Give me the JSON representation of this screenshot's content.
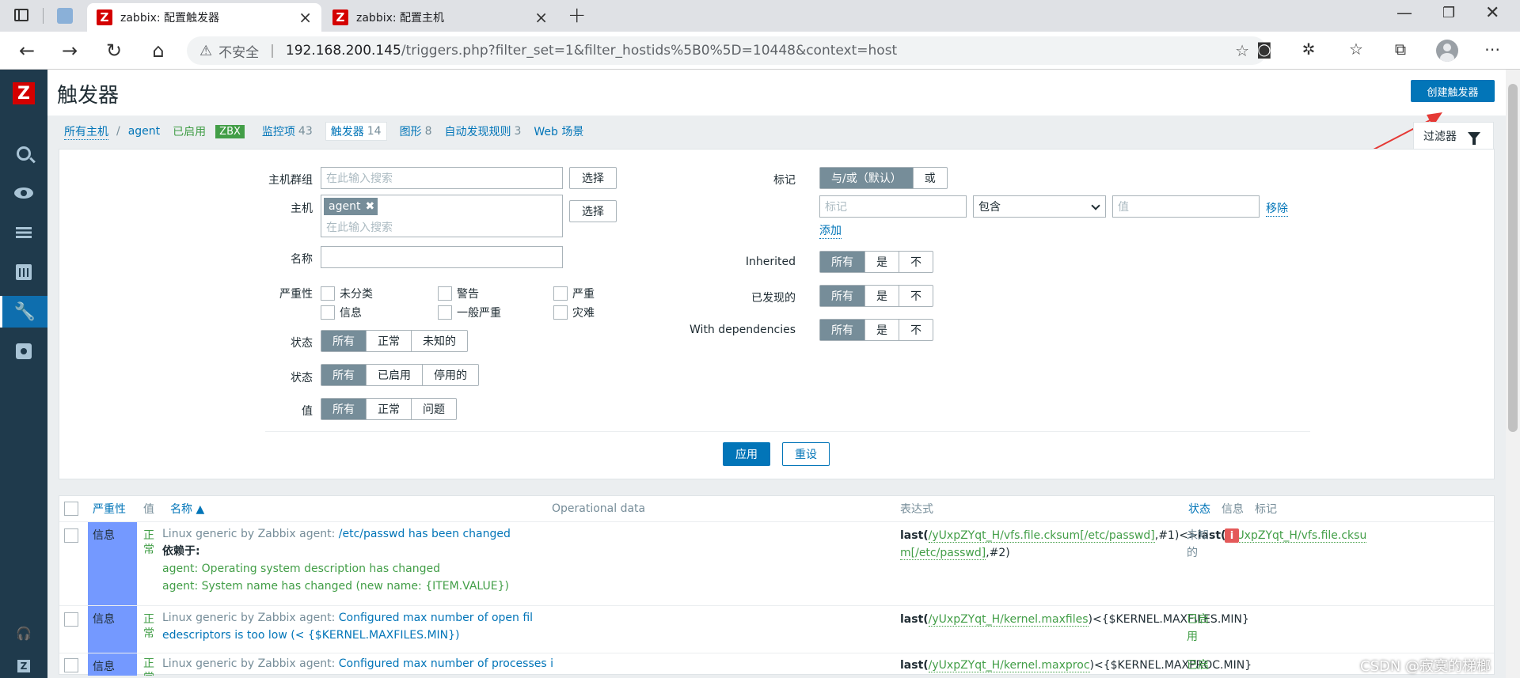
{
  "browser": {
    "tabs": [
      {
        "title": "zabbix: 配置触发器",
        "active": true
      },
      {
        "title": "zabbix: 配置主机",
        "active": false
      }
    ],
    "url_warning": "不安全",
    "url_host": "192.168.200.145",
    "url_path": "/triggers.php?filter_set=1&filter_hostids%5B0%5D=10448&context=host"
  },
  "header": {
    "title": "触发器",
    "create_button": "创建触发器"
  },
  "breadcrumb": {
    "all_hosts": "所有主机",
    "host": "agent",
    "enabled": "已启用",
    "zbx": "ZBX",
    "items": [
      {
        "label": "监控项",
        "count": "43"
      },
      {
        "label": "触发器",
        "count": "14"
      },
      {
        "label": "图形",
        "count": "8"
      },
      {
        "label": "自动发现规则",
        "count": "3"
      },
      {
        "label": "Web 场景",
        "count": ""
      }
    ],
    "filter_tab": "过滤器"
  },
  "filter": {
    "host_group_label": "主机群组",
    "host_label": "主机",
    "search_placeholder": "在此输入搜索",
    "select_button": "选择",
    "host_tag": "agent",
    "name_label": "名称",
    "severity_label": "严重性",
    "severities": [
      "未分类",
      "警告",
      "严重",
      "信息",
      "一般严重",
      "灾难"
    ],
    "state_label": "状态",
    "state_options": [
      "所有",
      "正常",
      "未知的"
    ],
    "status_label": "状态",
    "status_options": [
      "所有",
      "已启用",
      "停用的"
    ],
    "value_label": "值",
    "value_options": [
      "所有",
      "正常",
      "问题"
    ],
    "tags_label": "标记",
    "tags_options": [
      "与/或（默认）",
      "或"
    ],
    "tag_placeholder": "标记",
    "tag_operator": "包含",
    "value_placeholder": "值",
    "remove_link": "移除",
    "add_link": "添加",
    "inherited_label": "Inherited",
    "discovered_label": "已发现的",
    "dependencies_label": "With dependencies",
    "tri_options": [
      "所有",
      "是",
      "不"
    ],
    "apply": "应用",
    "reset": "重设"
  },
  "table": {
    "headers": {
      "severity": "严重性",
      "value": "值",
      "name": "名称 ▲",
      "opdata": "Operational data",
      "expression": "表达式",
      "status": "状态",
      "info": "信息",
      "tags": "标记"
    },
    "rows": [
      {
        "severity": "信息",
        "value": "正常",
        "template": "Linux generic by Zabbix agent:",
        "name": "/etc/passwd has been changed",
        "depends_label": "依赖于:",
        "depends": [
          "agent: Operating system description has changed",
          "agent: System name has changed (new name: {ITEM.VALUE})"
        ],
        "expr_parts": [
          "last(",
          "/yUxpZYqt_H/vfs.file.cksum[/etc/passwd]",
          ",#1)<>",
          "last(",
          "/yUxpZYqt_H/vfs.file.cksum[/etc/passwd]",
          ",#2)"
        ],
        "status": "未知的",
        "info": "i"
      },
      {
        "severity": "信息",
        "value": "正常",
        "template": "Linux generic by Zabbix agent:",
        "name": "Configured max number of open filedescriptors is too low (< {$KERNEL.MAXFILES.MIN})",
        "expr_parts": [
          "last(",
          "/yUxpZYqt_H/kernel.maxfiles",
          ")<{$KERNEL.MAXFILES.MIN}"
        ],
        "status": "已启用"
      },
      {
        "severity": "信息",
        "value": "正常",
        "template": "Linux generic by Zabbix agent:",
        "name": "Configured max number of processes i",
        "expr_parts": [
          "last(",
          "/yUxpZYqt_H/kernel.maxproc",
          ")<{$KERNEL.MAXPROC.MIN}"
        ],
        "status": "已启"
      }
    ]
  },
  "watermark": "CSDN @寂寞的梯榔"
}
